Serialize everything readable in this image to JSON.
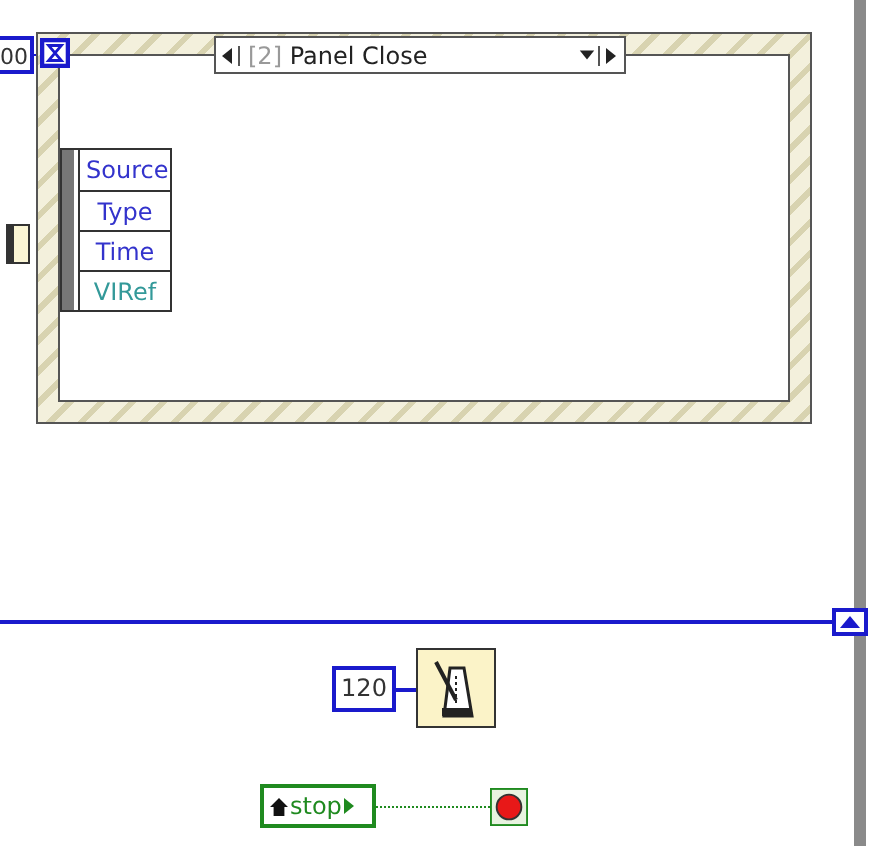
{
  "timeout_constant": {
    "value": "00"
  },
  "event_structure": {
    "case_index": "[2]",
    "case_name": "Panel Close",
    "event_data": [
      {
        "label": "Source",
        "color": "#3333cc"
      },
      {
        "label": "Type",
        "color": "#3333cc"
      },
      {
        "label": "Time",
        "color": "#3333cc"
      },
      {
        "label": "VIRef",
        "color": "#339999"
      }
    ]
  },
  "wait_constant": {
    "value": "120"
  },
  "stop_terminal": {
    "label": "stop"
  }
}
